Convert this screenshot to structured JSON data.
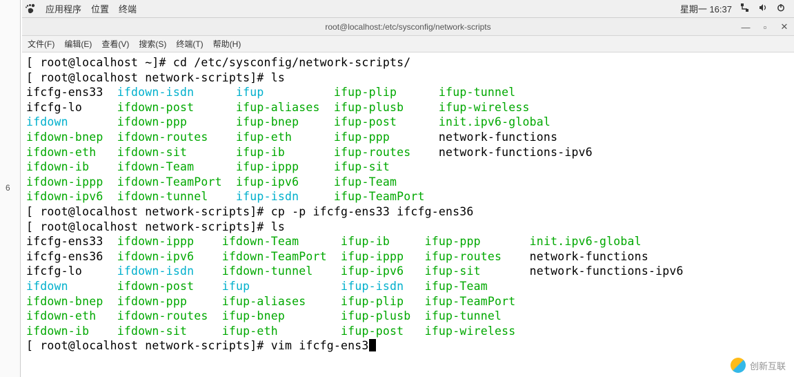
{
  "left_line_num": "6",
  "topbar": {
    "apps": "应用程序",
    "places": "位置",
    "terminal": "终端",
    "clock": "星期一 16:37"
  },
  "titlebar": {
    "title": "root@localhost:/etc/sysconfig/network-scripts"
  },
  "menubar": {
    "file": "文件(F)",
    "edit": "编辑(E)",
    "view": "查看(V)",
    "search": "搜索(S)",
    "terminal": "终端(T)",
    "help": "帮助(H)"
  },
  "term": {
    "p1_prompt": "[ root@localhost ~]# ",
    "p1_cmd": "cd /etc/sysconfig/network-scripts/",
    "p2_prompt": "[ root@localhost network-scripts]# ",
    "p2_cmd": "ls",
    "ls1": {
      "r0": {
        "a": "ifcfg-ens33",
        "b": "ifdown-isdn",
        "c": "ifup",
        "d": "ifup-plip",
        "e": "ifup-tunnel"
      },
      "r1": {
        "a": "ifcfg-lo",
        "b": "ifdown-post",
        "c": "ifup-aliases",
        "d": "ifup-plusb",
        "e": "ifup-wireless"
      },
      "r2": {
        "a": "ifdown",
        "b": "ifdown-ppp",
        "c": "ifup-bnep",
        "d": "ifup-post",
        "e": "init.ipv6-global"
      },
      "r3": {
        "a": "ifdown-bnep",
        "b": "ifdown-routes",
        "c": "ifup-eth",
        "d": "ifup-ppp",
        "e": "network-functions"
      },
      "r4": {
        "a": "ifdown-eth",
        "b": "ifdown-sit",
        "c": "ifup-ib",
        "d": "ifup-routes",
        "e": "network-functions-ipv6"
      },
      "r5": {
        "a": "ifdown-ib",
        "b": "ifdown-Team",
        "c": "ifup-ippp",
        "d": "ifup-sit",
        "e": ""
      },
      "r6": {
        "a": "ifdown-ippp",
        "b": "ifdown-TeamPort",
        "c": "ifup-ipv6",
        "d": "ifup-Team",
        "e": ""
      },
      "r7": {
        "a": "ifdown-ipv6",
        "b": "ifdown-tunnel",
        "c": "ifup-isdn",
        "d": "ifup-TeamPort",
        "e": ""
      }
    },
    "p3_prompt": "[ root@localhost network-scripts]# ",
    "p3_cmd": "cp -p ifcfg-ens33 ifcfg-ens36",
    "p4_prompt": "[ root@localhost network-scripts]# ",
    "p4_cmd": "ls",
    "ls2": {
      "r0": {
        "a": "ifcfg-ens33",
        "b": "ifdown-ippp",
        "c": "ifdown-Team",
        "d": "ifup-ib",
        "e": "ifup-ppp",
        "f": "init.ipv6-global"
      },
      "r1": {
        "a": "ifcfg-ens36",
        "b": "ifdown-ipv6",
        "c": "ifdown-TeamPort",
        "d": "ifup-ippp",
        "e": "ifup-routes",
        "f": "network-functions"
      },
      "r2": {
        "a": "ifcfg-lo",
        "b": "ifdown-isdn",
        "c": "ifdown-tunnel",
        "d": "ifup-ipv6",
        "e": "ifup-sit",
        "f": "network-functions-ipv6"
      },
      "r3": {
        "a": "ifdown",
        "b": "ifdown-post",
        "c": "ifup",
        "d": "ifup-isdn",
        "e": "ifup-Team",
        "f": ""
      },
      "r4": {
        "a": "ifdown-bnep",
        "b": "ifdown-ppp",
        "c": "ifup-aliases",
        "d": "ifup-plip",
        "e": "ifup-TeamPort",
        "f": ""
      },
      "r5": {
        "a": "ifdown-eth",
        "b": "ifdown-routes",
        "c": "ifup-bnep",
        "d": "ifup-plusb",
        "e": "ifup-tunnel",
        "f": ""
      },
      "r6": {
        "a": "ifdown-ib",
        "b": "ifdown-sit",
        "c": "ifup-eth",
        "d": "ifup-post",
        "e": "ifup-wireless",
        "f": ""
      }
    },
    "p5_prompt": "[ root@localhost network-scripts]# ",
    "p5_cmd": "vim ifcfg-ens3"
  },
  "watermark": "创新互联"
}
